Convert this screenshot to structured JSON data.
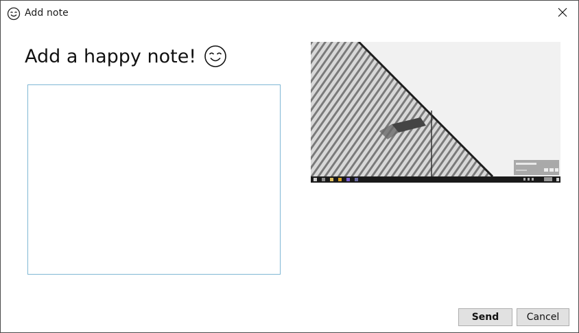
{
  "window": {
    "title": "Add note",
    "app_icon": "smiley-face-icon",
    "close_icon": "close-icon"
  },
  "main": {
    "heading": "Add a happy note!",
    "heading_emoji": "happy-face-icon",
    "note_value": "",
    "screenshot_taskbar_popup": "Google Chrome"
  },
  "buttons": {
    "send": "Send",
    "cancel": "Cancel"
  },
  "colors": {
    "input_border": "#7fb7d4",
    "button_bg": "#e1e1e1",
    "button_border": "#adadad"
  }
}
